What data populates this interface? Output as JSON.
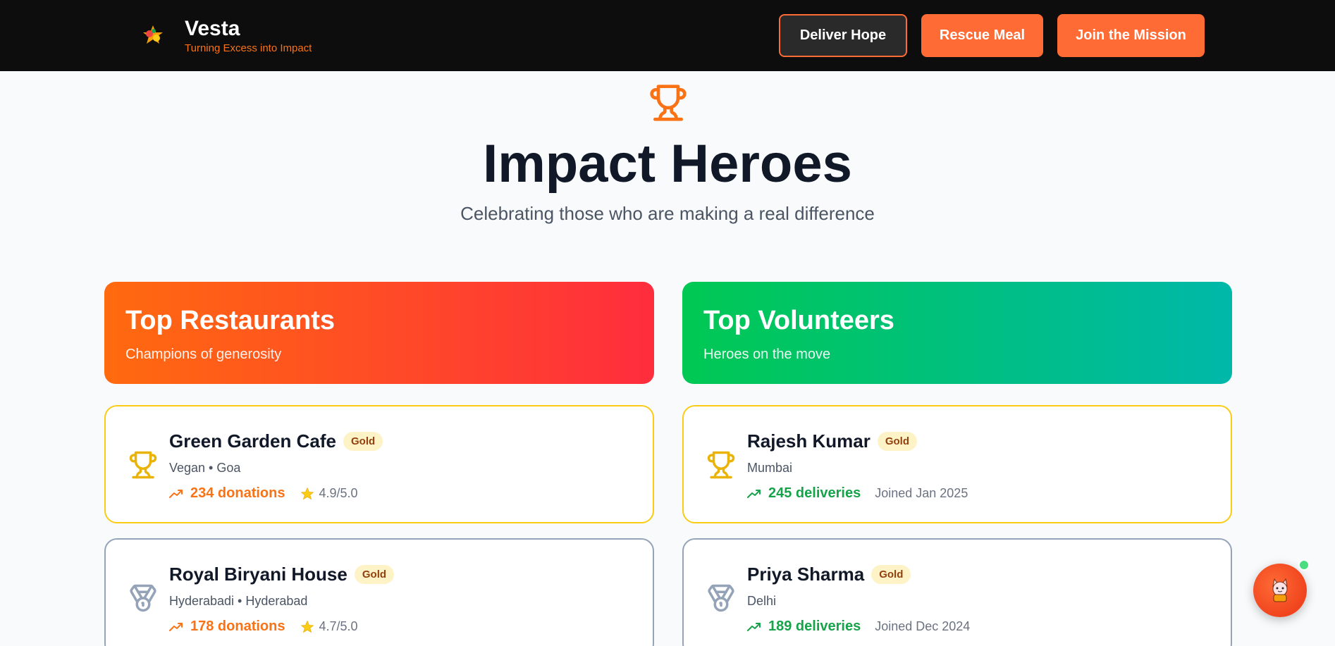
{
  "brand": {
    "name": "Vesta",
    "tagline": "Turning Excess into Impact"
  },
  "nav": {
    "deliver_label": "Deliver Hope",
    "rescue_label": "Rescue Meal",
    "join_label": "Join the Mission"
  },
  "hero": {
    "title": "Impact Heroes",
    "subtitle": "Celebrating those who are making a real difference"
  },
  "restaurants": {
    "title": "Top Restaurants",
    "subtitle": "Champions of generosity",
    "items": [
      {
        "name": "Green Garden Cafe",
        "badge": "Gold",
        "meta": "Vegan • Goa",
        "stat": "234 donations",
        "rating": "4.9/5.0",
        "icon": "trophy-icon"
      },
      {
        "name": "Royal Biryani House",
        "badge": "Gold",
        "meta": "Hyderabadi • Hyderabad",
        "stat": "178 donations",
        "rating": "4.7/5.0",
        "icon": "medal-icon"
      }
    ]
  },
  "volunteers": {
    "title": "Top Volunteers",
    "subtitle": "Heroes on the move",
    "items": [
      {
        "name": "Rajesh Kumar",
        "badge": "Gold",
        "meta": "Mumbai",
        "stat": "245 deliveries",
        "joined": "Joined Jan 2025",
        "icon": "trophy-icon"
      },
      {
        "name": "Priya Sharma",
        "badge": "Gold",
        "meta": "Delhi",
        "stat": "189 deliveries",
        "joined": "Joined Dec 2024",
        "icon": "medal-icon"
      }
    ]
  },
  "colors": {
    "accent": "#ff6b35",
    "orange_stat": "#f97316",
    "green_stat": "#16a34a",
    "gold_border": "#facc15",
    "silver_border": "#94a3b8"
  }
}
